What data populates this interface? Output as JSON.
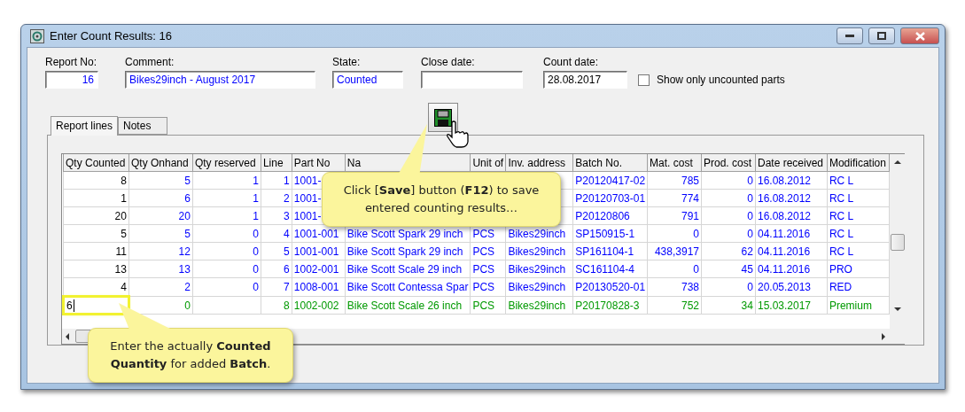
{
  "window": {
    "title": "Enter Count Results: 16"
  },
  "fields": [
    {
      "label": "Report No:",
      "value": "16",
      "color": "#0000ff"
    },
    {
      "label": "Comment:",
      "value": "Bikes29inch - August 2017",
      "color": "#0000ff"
    },
    {
      "label": "State:",
      "value": "Counted",
      "color": "#0000ff"
    },
    {
      "label": "Close date:"
    },
    {
      "label": "Count date:",
      "value": "28.08.2017",
      "color": "#000000"
    }
  ],
  "show_only_uncounted": {
    "label": "Show only uncounted parts",
    "checked": false
  },
  "tabs": [
    {
      "label": "Report lines",
      "selected": true
    },
    {
      "label": "Notes",
      "selected": false
    }
  ],
  "table": {
    "columns": [
      "Qty Counted",
      "Qty Onhand",
      "Qty reserved",
      "Line",
      "Part No",
      "Na",
      "Unit of",
      "Inv. address",
      "Batch No.",
      "Mat. cost",
      "Prod. cost",
      "Date received",
      "Modification"
    ],
    "rows": [
      {
        "color": "#0000ff",
        "editing": false,
        "cells": [
          "8",
          "5",
          "1",
          "1",
          "1001-",
          null,
          null,
          null,
          "P20120417-02",
          "785",
          "0",
          "16.08.2012",
          "RC L"
        ]
      },
      {
        "color": "#0000ff",
        "editing": false,
        "cells": [
          "1",
          "6",
          "1",
          "2",
          "1001-",
          null,
          null,
          null,
          "P20120703-01",
          "774",
          "0",
          "16.08.2012",
          "RC L"
        ]
      },
      {
        "color": "#0000ff",
        "editing": false,
        "cells": [
          "20",
          "20",
          "1",
          "3",
          "1001-",
          null,
          null,
          null,
          "P20120806",
          "791",
          "0",
          "16.08.2012",
          "RC L"
        ]
      },
      {
        "color": "#0000ff",
        "editing": false,
        "cells": [
          "5",
          "5",
          "0",
          "4",
          "1001-001",
          "Bike Scott Spark 29 inch",
          "PCS",
          "Bikes29inch",
          "SP150915-1",
          "0",
          "0",
          "04.11.2016",
          "RC L"
        ]
      },
      {
        "color": "#0000ff",
        "editing": false,
        "cells": [
          "11",
          "12",
          "0",
          "5",
          "1001-001",
          "Bike Scott Spark 29 inch",
          "PCS",
          "Bikes29inch",
          "SP161104-1",
          "438,3917",
          "62",
          "04.11.2016",
          "RC L"
        ]
      },
      {
        "color": "#0000ff",
        "editing": false,
        "cells": [
          "13",
          "13",
          "0",
          "6",
          "1002-001",
          "Bike Scott Scale 29 inch",
          "PCS",
          "Bikes29inch",
          "SC161104-4",
          "0",
          "45",
          "04.11.2016",
          "PRO"
        ]
      },
      {
        "color": "#0000ff",
        "editing": false,
        "cells": [
          "4",
          "2",
          "0",
          "7",
          "1008-001",
          "Bike Scott Contessa Spar",
          "PCS",
          "Bikes29inch",
          "P20130520-01",
          "738",
          "0",
          "20.05.2013",
          "RED"
        ]
      },
      {
        "color": "#009900",
        "editing": true,
        "cells": [
          "6",
          "0",
          null,
          "8",
          "1002-002",
          "Bike Scott Scale 26 inch",
          "PCS",
          "Bikes29inch",
          "P20170828-3",
          "752",
          "34",
          "15.03.2017",
          "Premium"
        ]
      }
    ]
  },
  "callouts": [
    {
      "text": "Click [**Save**] button (**F12**) to save entered counting results…"
    },
    {
      "text": "Enter the actually **Counted Quantity** for added **Batch**."
    }
  ]
}
